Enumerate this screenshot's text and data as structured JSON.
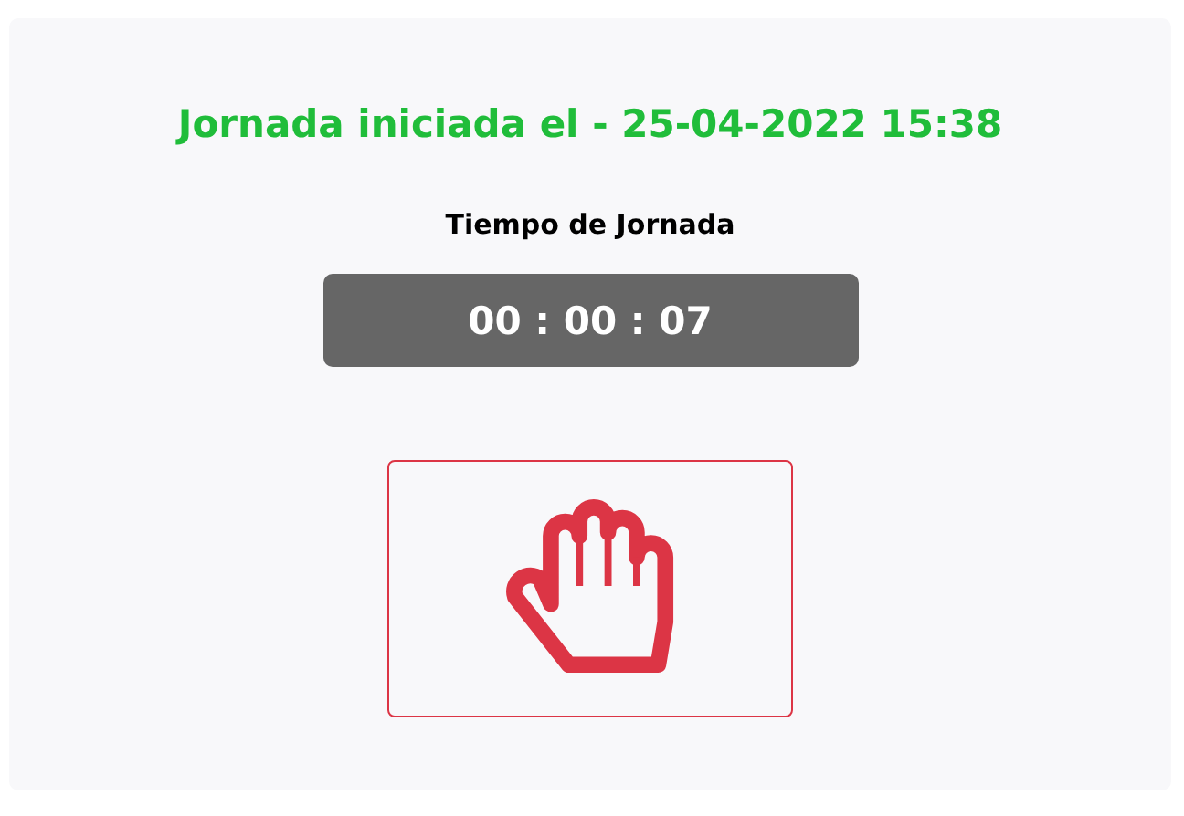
{
  "heading": "Jornada iniciada el - 25-04-2022 15:38",
  "timer": {
    "label": "Tiempo de Jornada",
    "value": "00 : 00 : 07"
  },
  "stop_button": {
    "kind": "stop"
  }
}
